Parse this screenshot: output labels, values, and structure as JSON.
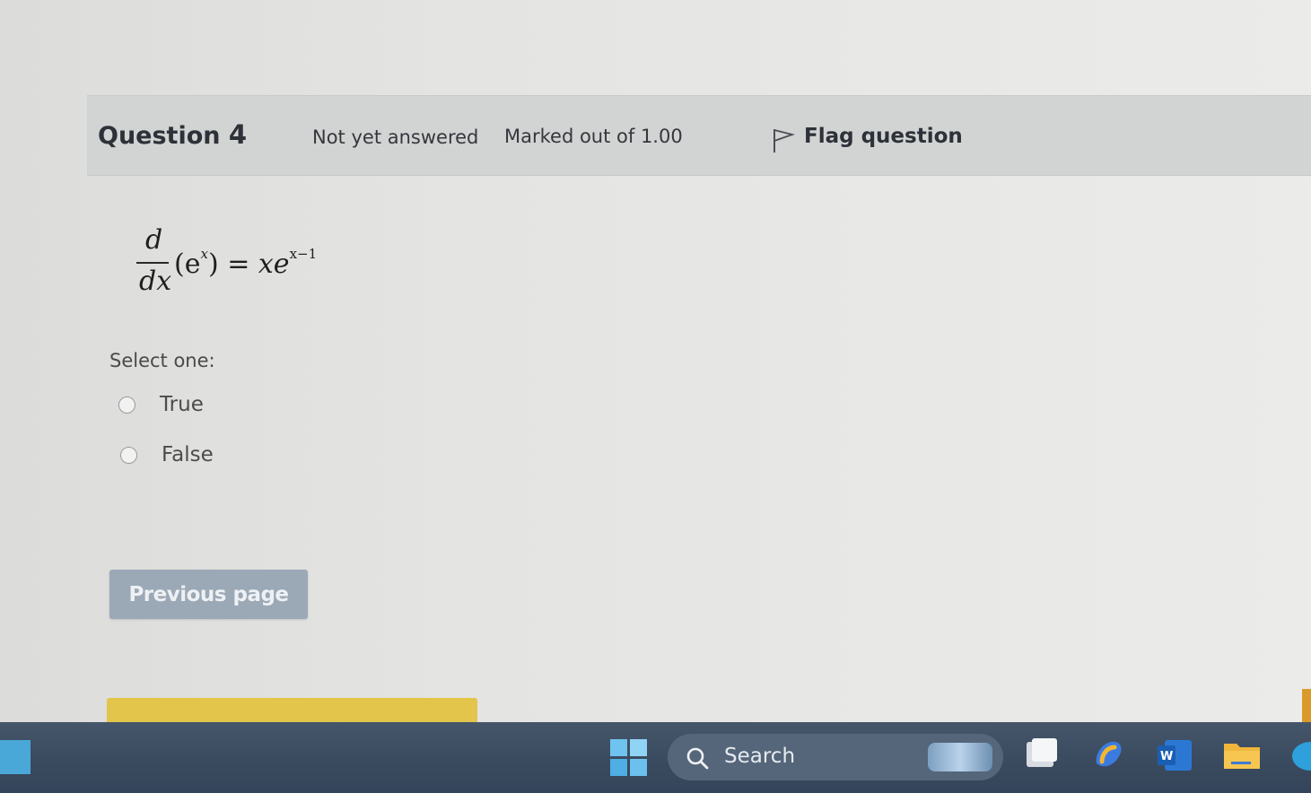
{
  "question": {
    "label": "Question",
    "number": "4",
    "state": "Not yet answered",
    "grade": "Marked out of 1.00",
    "flag_label": "Flag question"
  },
  "formula": {
    "frac_numerator": "d",
    "frac_denominator": "dx",
    "lhs_open": "(e",
    "lhs_exponent": "x",
    "lhs_close": ")",
    "equals": "=",
    "rhs_base": "xe",
    "rhs_exponent": "x−1"
  },
  "answer": {
    "prompt": "Select one:",
    "options": [
      {
        "label": "True",
        "selected": false
      },
      {
        "label": "False",
        "selected": false
      }
    ]
  },
  "navigation": {
    "previous_label": "Previous page"
  },
  "taskbar": {
    "search_label": "Search",
    "icons": [
      "start-icon",
      "search-icon",
      "files-icon",
      "copilot-icon",
      "word-icon",
      "folder-icon",
      "edge-icon"
    ]
  },
  "colors": {
    "header_bg": "#d2d3d3",
    "button_bg": "#9ba8b6",
    "taskbar_bg": "#3a4a5e",
    "accent_yellow": "#e2c54a"
  }
}
